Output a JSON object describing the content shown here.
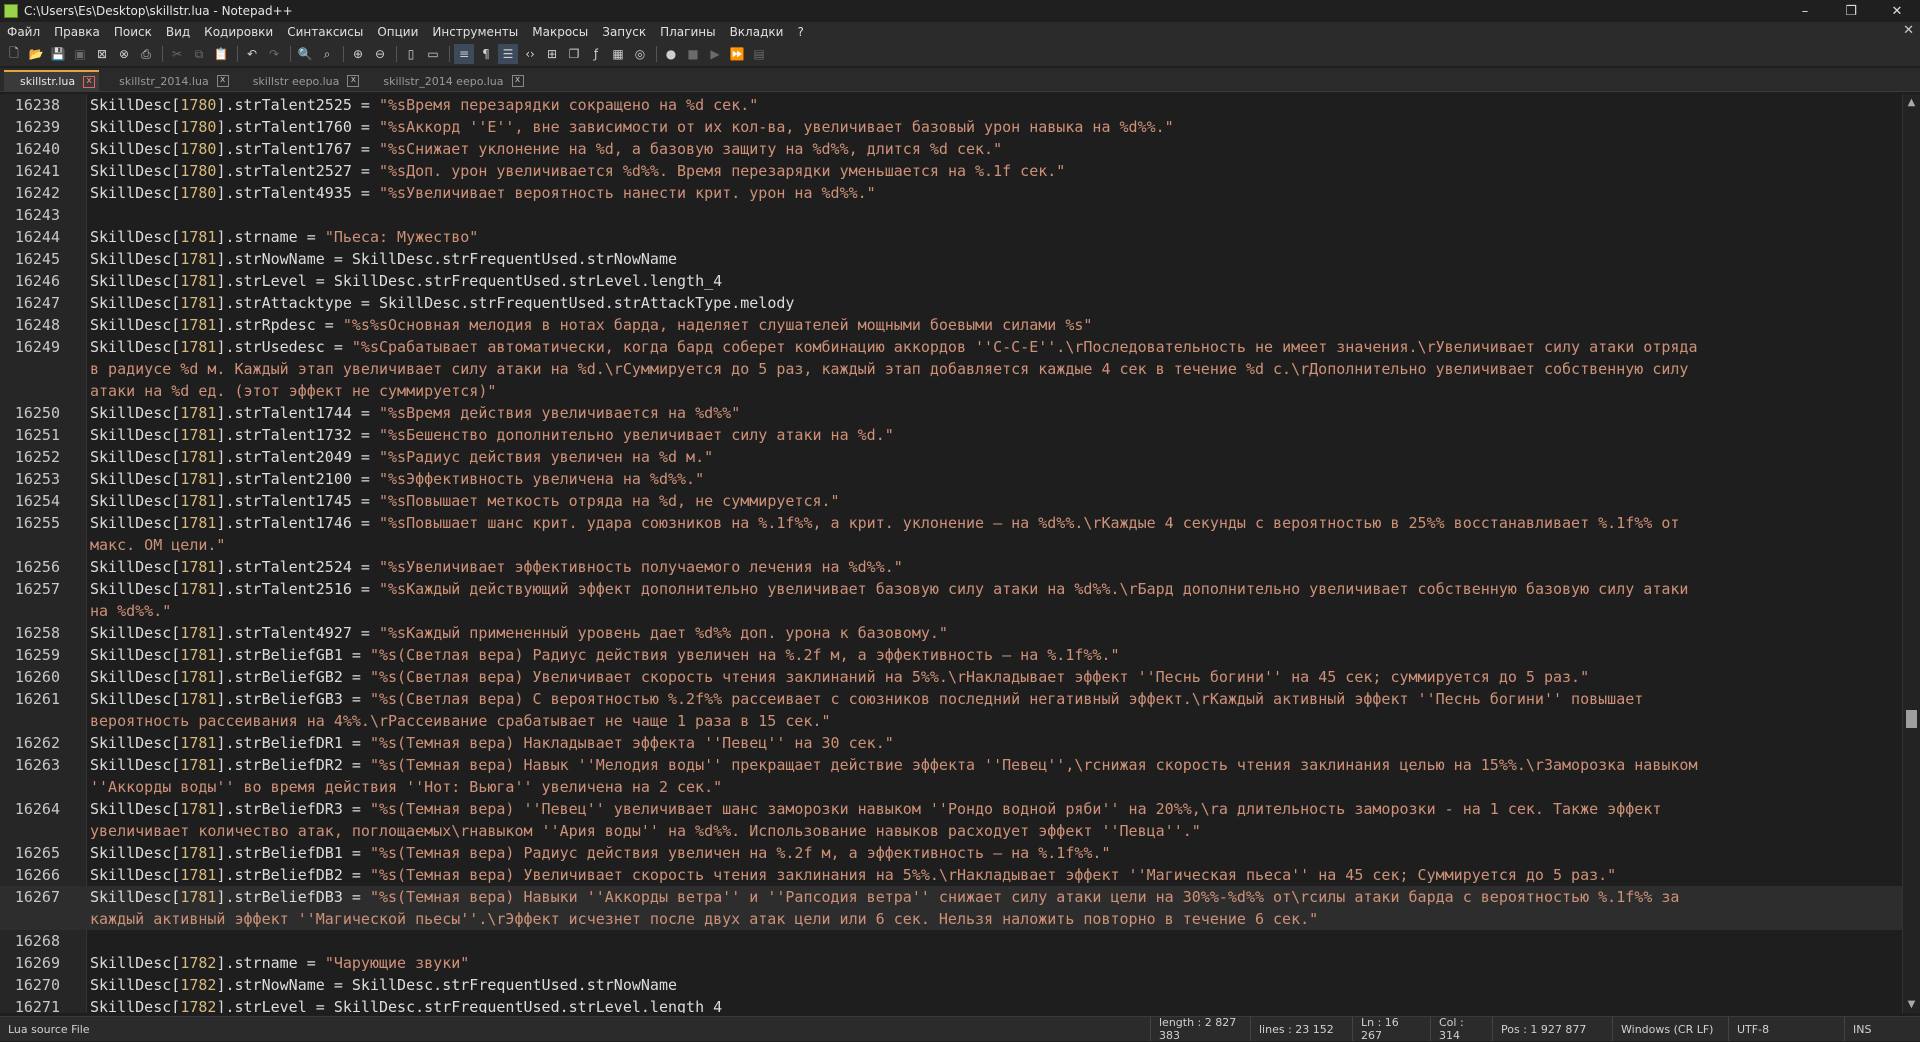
{
  "window": {
    "title": "C:\\Users\\Es\\Desktop\\skillstr.lua - Notepad++",
    "min": "–",
    "max": "❐",
    "close": "✕"
  },
  "menu": [
    "Файл",
    "Правка",
    "Поиск",
    "Вид",
    "Кодировки",
    "Синтаксисы",
    "Опции",
    "Инструменты",
    "Макросы",
    "Запуск",
    "Плагины",
    "Вкладки",
    "?"
  ],
  "menu_close": "✕",
  "tabs": [
    {
      "label": "skillstr.lua",
      "active": true
    },
    {
      "label": "skillstr_2014.lua",
      "active": false
    },
    {
      "label": "skillstr eepo.lua",
      "active": false
    },
    {
      "label": "skillstr_2014 eepo.lua",
      "active": false
    }
  ],
  "tab_close": "x",
  "editor": {
    "lines": [
      {
        "num": "16238",
        "pre": "SkillDesc[",
        "n": "1780",
        "mid": "].strTalent2525 = ",
        "str": "\"%sВремя перезарядки сокращено на %d сек.\""
      },
      {
        "num": "16239",
        "pre": "SkillDesc[",
        "n": "1780",
        "mid": "].strTalent1760 = ",
        "str": "\"%sАккорд ''Е'', вне зависимости от их кол-ва, увеличивает базовый урон навыка на %d%%.\""
      },
      {
        "num": "16240",
        "pre": "SkillDesc[",
        "n": "1780",
        "mid": "].strTalent1767 = ",
        "str": "\"%sСнижает уклонение на %d, а базовую защиту на %d%%, длится %d сек.\""
      },
      {
        "num": "16241",
        "pre": "SkillDesc[",
        "n": "1780",
        "mid": "].strTalent2527 = ",
        "str": "\"%sДоп. урон увеличивается %d%%. Время перезарядки уменьшается на %.1f сек.\""
      },
      {
        "num": "16242",
        "pre": "SkillDesc[",
        "n": "1780",
        "mid": "].strTalent4935 = ",
        "str": "\"%sУвеличивает вероятность нанести крит. урон на %d%%.\""
      },
      {
        "num": "16243",
        "pre": "",
        "n": "",
        "mid": "",
        "str": ""
      },
      {
        "num": "16244",
        "pre": "SkillDesc[",
        "n": "1781",
        "mid": "].strname     = ",
        "str": "\"Пьеса: Мужество\""
      },
      {
        "num": "16245",
        "pre": "SkillDesc[",
        "n": "1781",
        "mid": "].strNowName = SkillDesc.strFrequentUsed.strNowName",
        "str": ""
      },
      {
        "num": "16246",
        "pre": "SkillDesc[",
        "n": "1781",
        "mid": "].strLevel = SkillDesc.strFrequentUsed.strLevel.length_4",
        "str": ""
      },
      {
        "num": "16247",
        "pre": "SkillDesc[",
        "n": "1781",
        "mid": "].strAttacktype = SkillDesc.strFrequentUsed.strAttackType.melody",
        "str": ""
      },
      {
        "num": "16248",
        "pre": "SkillDesc[",
        "n": "1781",
        "mid": "].strRpdesc = ",
        "str": "\"%s%sОсновная мелодия в нотах барда, наделяет слушателей мощными боевыми силами %s\""
      },
      {
        "num": "16249",
        "pre": "SkillDesc[",
        "n": "1781",
        "mid": "].strUsedesc = ",
        "str": "\"%sСрабатывает автоматически, когда бард соберет комбинацию аккордов ''С-С-Е''.\\rПоследовательность не имеет значения.\\rУвеличивает силу атаки отряда"
      },
      {
        "num": "",
        "pre": "",
        "n": "",
        "mid": "",
        "str": "в радиусе %d м. Каждый этап увеличивает силу атаки на %d.\\rСуммируется до 5 раз, каждый этап добавляется каждые 4 сек в течение %d с.\\rДополнительно увеличивает собственную силу"
      },
      {
        "num": "",
        "pre": "",
        "n": "",
        "mid": "",
        "str": "атаки на %d ед. (этот эффект не суммируется)\""
      },
      {
        "num": "16250",
        "pre": "SkillDesc[",
        "n": "1781",
        "mid": "].strTalent1744 = ",
        "str": "\"%sВремя действия увеличивается на %d%%\""
      },
      {
        "num": "16251",
        "pre": "SkillDesc[",
        "n": "1781",
        "mid": "].strTalent1732 = ",
        "str": "\"%sБешенство дополнительно увеличивает силу атаки на %d.\""
      },
      {
        "num": "16252",
        "pre": "SkillDesc[",
        "n": "1781",
        "mid": "].strTalent2049 = ",
        "str": "\"%sРадиус действия увеличен на %d м.\""
      },
      {
        "num": "16253",
        "pre": "SkillDesc[",
        "n": "1781",
        "mid": "].strTalent2100 = ",
        "str": "\"%sЭффективность увеличена на %d%%.\""
      },
      {
        "num": "16254",
        "pre": "SkillDesc[",
        "n": "1781",
        "mid": "].strTalent1745 = ",
        "str": "\"%sПовышает меткость отряда на %d, не суммируется.\""
      },
      {
        "num": "16255",
        "pre": "SkillDesc[",
        "n": "1781",
        "mid": "].strTalent1746 = ",
        "str": "\"%sПовышает шанс крит. удара союзников на %.1f%%, а крит. уклонение – на %d%%.\\rКаждые 4 секунды с вероятностью в 25%% восстанавливает %.1f%% от"
      },
      {
        "num": "",
        "pre": "",
        "n": "",
        "mid": "",
        "str": "макс. ОМ цели.\""
      },
      {
        "num": "16256",
        "pre": "SkillDesc[",
        "n": "1781",
        "mid": "].strTalent2524 = ",
        "str": "\"%sУвеличивает эффективность получаемого лечения на %d%%.\""
      },
      {
        "num": "16257",
        "pre": "SkillDesc[",
        "n": "1781",
        "mid": "].strTalent2516 = ",
        "str": "\"%sКаждый действующий эффект дополнительно увеличивает базовую силу атаки на %d%%.\\rБард дополнительно увеличивает собственную базовую силу атаки"
      },
      {
        "num": "",
        "pre": "",
        "n": "",
        "mid": "",
        "str": "на %d%%.\""
      },
      {
        "num": "16258",
        "pre": "SkillDesc[",
        "n": "1781",
        "mid": "].strTalent4927 = ",
        "str": "\"%sКаждый примененный уровень дает %d%% доп. урона к базовому.\""
      },
      {
        "num": "16259",
        "pre": "SkillDesc[",
        "n": "1781",
        "mid": "].strBeliefGB1 = ",
        "str": "\"%s(Светлая вера) Радиус действия увеличен на %.2f м, а эффективность – на %.1f%%.\""
      },
      {
        "num": "16260",
        "pre": "SkillDesc[",
        "n": "1781",
        "mid": "].strBeliefGB2 = ",
        "str": "\"%s(Светлая вера) Увеличивает скорость чтения заклинаний на 5%%.\\rНакладывает эффект ''Песнь богини'' на 45 сек; суммируется до 5 раз.\""
      },
      {
        "num": "16261",
        "pre": "SkillDesc[",
        "n": "1781",
        "mid": "].strBeliefGB3 = ",
        "str": "\"%s(Светлая вера) С вероятностью %.2f%% рассеивает с союзников последний негативный эффект.\\rКаждый активный эффект ''Песнь богини'' повышает"
      },
      {
        "num": "",
        "pre": "",
        "n": "",
        "mid": "",
        "str": "вероятность рассеивания на 4%%.\\rРассеивание срабатывает не чаще 1 раза в 15 сек.\""
      },
      {
        "num": "16262",
        "pre": "SkillDesc[",
        "n": "1781",
        "mid": "].strBeliefDR1 = ",
        "str": "\"%s(Темная вера) Накладывает эффекта ''Певец'' на 30 сек.\""
      },
      {
        "num": "16263",
        "pre": "SkillDesc[",
        "n": "1781",
        "mid": "].strBeliefDR2 = ",
        "str": "\"%s(Темная вера) Навык ''Мелодия воды'' прекращает действие эффекта ''Певец'',\\rснижая скорость чтения заклинания целью на 15%%.\\rЗаморозка навыком"
      },
      {
        "num": "",
        "pre": "",
        "n": "",
        "mid": "",
        "str": "''Аккорды воды'' во время действия ''Нот: Вьюга'' увеличена на 2 сек.\""
      },
      {
        "num": "16264",
        "pre": "SkillDesc[",
        "n": "1781",
        "mid": "].strBeliefDR3 = ",
        "str": "\"%s(Темная вера) ''Певец'' увеличивает шанс заморозки навыком ''Рондо водной ряби'' на 20%%,\\rа длительность заморозки - на 1 сек. Также эффект"
      },
      {
        "num": "",
        "pre": "",
        "n": "",
        "mid": "",
        "str": "увеличивает количество атак, поглощаемых\\rнавыком ''Ария воды'' на %d%%. Использование навыков расходует эффект ''Певца''.\""
      },
      {
        "num": "16265",
        "pre": "SkillDesc[",
        "n": "1781",
        "mid": "].strBeliefDB1 = ",
        "str": "\"%s(Темная вера) Радиус действия увеличен на %.2f м, а эффективность – на %.1f%%.\""
      },
      {
        "num": "16266",
        "pre": "SkillDesc[",
        "n": "1781",
        "mid": "].strBeliefDB2 = ",
        "str": "\"%s(Темная вера) Увеличивает скорость чтения заклинания на 5%%.\\rНакладывает эффект ''Магическая пьеса'' на 45 сек; Суммируется до 5 раз.\""
      },
      {
        "num": "16267",
        "pre": "SkillDesc[",
        "n": "1781",
        "mid": "].strBeliefDB3 = ",
        "str": "\"%s(Темная вера) Навыки ''Аккорды ветра'' и ''Рапсодия ветра'' снижает силу атаки цели на 30%%-%d%% от\\rсилы атаки барда с вероятностью %.1f%% за",
        "cur": true
      },
      {
        "num": "",
        "pre": "",
        "n": "",
        "mid": "",
        "str": "каждый активный эффект ''Магической пьесы''.\\rЭффект исчезнет после двух атак цели или 6 сек. Нельзя наложить повторно в течение 6 сек.\"",
        "cur": true
      },
      {
        "num": "16268",
        "pre": "",
        "n": "",
        "mid": "",
        "str": ""
      },
      {
        "num": "16269",
        "pre": "SkillDesc[",
        "n": "1782",
        "mid": "].strname     = ",
        "str": "\"Чарующие звуки\""
      },
      {
        "num": "16270",
        "pre": "SkillDesc[",
        "n": "1782",
        "mid": "].strNowName = SkillDesc.strFrequentUsed.strNowName",
        "str": ""
      },
      {
        "num": "16271",
        "pre": "SkillDesc[",
        "n": "1782",
        "mid": "].strLevel = SkillDesc.strFrequentUsed.strLevel.length_4",
        "str": ""
      }
    ]
  },
  "status": {
    "filetype": "Lua source File",
    "length": "length : 2 827 383",
    "lines": "lines : 23 152",
    "ln": "Ln : 16 267",
    "col": "Col : 314",
    "pos": "Pos : 1 927 877",
    "eol": "Windows (CR LF)",
    "encoding": "UTF-8",
    "mode": "INS"
  }
}
